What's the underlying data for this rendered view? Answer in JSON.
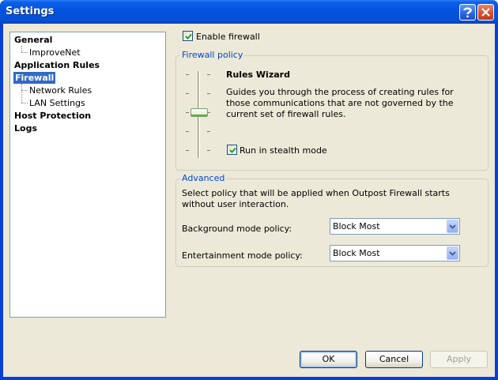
{
  "window": {
    "title": "Settings"
  },
  "titlebar": {
    "help_icon": "help-icon",
    "close_icon": "close-icon"
  },
  "tree": {
    "items": [
      {
        "label": "General"
      },
      {
        "label": "ImproveNet"
      },
      {
        "label": "Application Rules"
      },
      {
        "label": "Firewall"
      },
      {
        "label": "Network Rules"
      },
      {
        "label": "LAN Settings"
      },
      {
        "label": "Host Protection"
      },
      {
        "label": "Logs"
      }
    ],
    "selected": "Firewall"
  },
  "firewall": {
    "enable_label": "Enable firewall",
    "enable_checked": true,
    "policy_group_title": "Firewall policy",
    "wizard_title": "Rules Wizard",
    "wizard_description": "Guides you through the process of creating rules for those communications that are not governed by the current set of firewall rules.",
    "stealth_label": "Run in stealth mode",
    "stealth_checked": true
  },
  "advanced": {
    "group_title": "Advanced",
    "description": "Select policy that will be applied when Outpost Firewall starts without user interaction.",
    "background_label": "Background mode policy:",
    "background_value": "Block Most",
    "entertainment_label": "Entertainment mode policy:",
    "entertainment_value": "Block Most"
  },
  "buttons": {
    "ok": "OK",
    "cancel": "Cancel",
    "apply": "Apply"
  },
  "colors": {
    "titlebar": "#0553e0",
    "selection": "#316ac5",
    "group_title": "#0046d5",
    "dialog_bg": "#ece9d8"
  }
}
